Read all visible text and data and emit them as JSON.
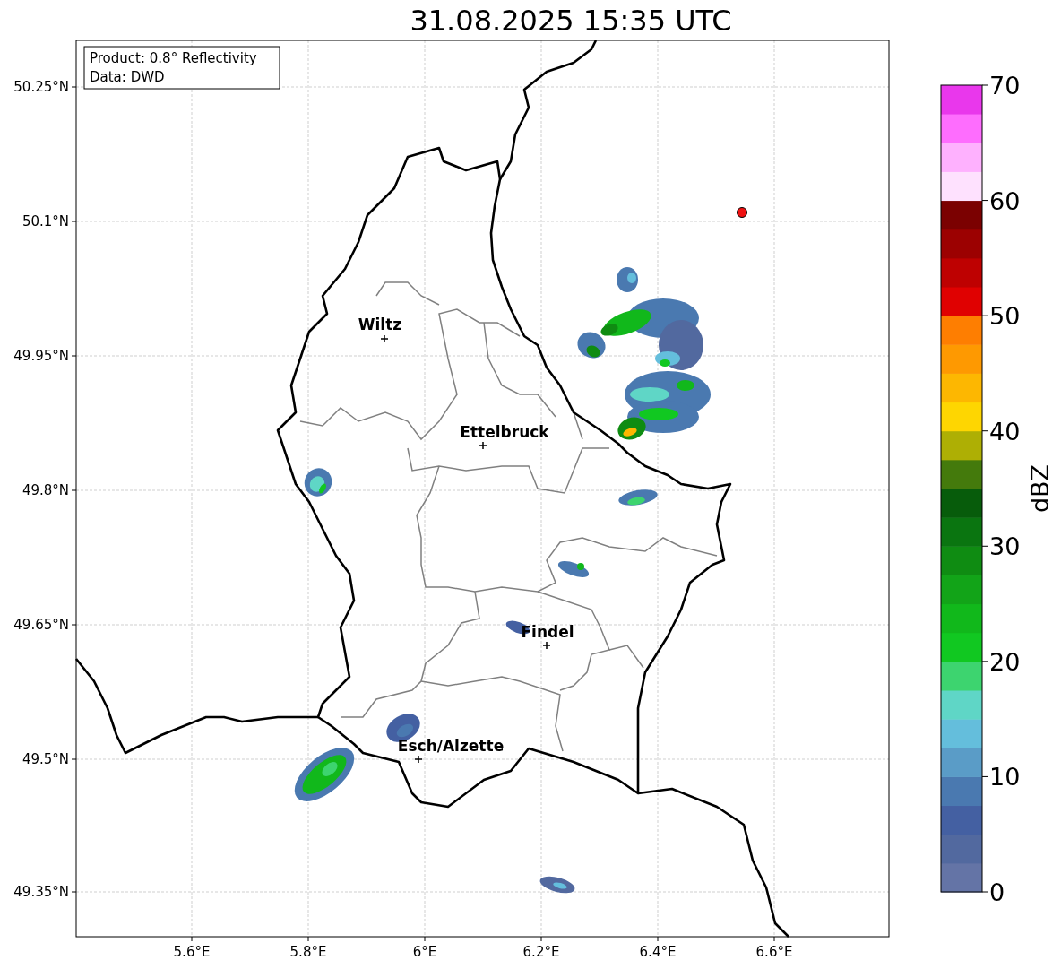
{
  "title": "31.08.2025 15:35 UTC",
  "info_box": [
    "Product: 0.8° Reflectivity",
    "Data: DWD"
  ],
  "map": {
    "lat_ticks": [
      "50.25°N",
      "50.1°N",
      "49.95°N",
      "49.8°N",
      "49.65°N",
      "49.5°N",
      "49.35°N"
    ],
    "lon_ticks": [
      "5.6°E",
      "5.8°E",
      "6°E",
      "6.2°E",
      "6.4°E",
      "6.6°E"
    ],
    "cities": [
      {
        "name": "Wiltz"
      },
      {
        "name": "Ettelbruck"
      },
      {
        "name": "Findel"
      },
      {
        "name": "Esch/Alzette"
      }
    ]
  },
  "colorbar": {
    "label": "dBZ",
    "ticks": [
      "70",
      "60",
      "50",
      "40",
      "30",
      "20",
      "10",
      "0"
    ],
    "bins": [
      {
        "color": "#6474a6"
      },
      {
        "color": "#52699f"
      },
      {
        "color": "#4460a2"
      },
      {
        "color": "#4a79b0"
      },
      {
        "color": "#5a9cc7"
      },
      {
        "color": "#64bedc"
      },
      {
        "color": "#5fd6c6"
      },
      {
        "color": "#3dd46f"
      },
      {
        "color": "#11c821"
      },
      {
        "color": "#11b81b"
      },
      {
        "color": "#12a418"
      },
      {
        "color": "#0f8c12"
      },
      {
        "color": "#0a7510"
      },
      {
        "color": "#075c0b"
      },
      {
        "color": "#447a0c"
      },
      {
        "color": "#aeaf04"
      },
      {
        "color": "#fed601"
      },
      {
        "color": "#fdb701"
      },
      {
        "color": "#fe9901"
      },
      {
        "color": "#fe7e01"
      },
      {
        "color": "#e00101"
      },
      {
        "color": "#be0101"
      },
      {
        "color": "#9c0101"
      },
      {
        "color": "#7b0101"
      },
      {
        "color": "#fee1fe"
      },
      {
        "color": "#feb1fe"
      },
      {
        "color": "#fe6dfe"
      },
      {
        "color": "#e937ec"
      }
    ]
  }
}
